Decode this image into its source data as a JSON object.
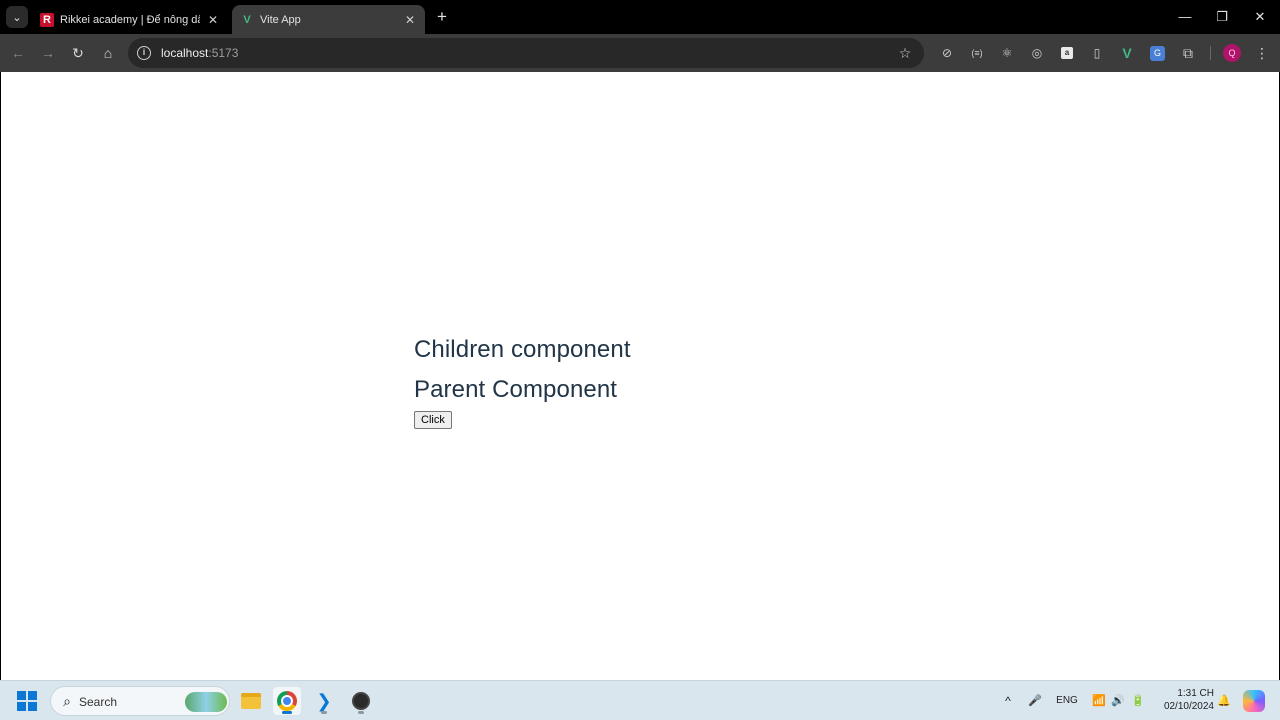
{
  "browser": {
    "tabs": [
      {
        "favicon": "rikkei-favicon",
        "favicon_glyph": "R",
        "title": "Rikkei academy | Để nông dân b",
        "close_glyph": "✕"
      },
      {
        "favicon": "vite-vue-favicon",
        "favicon_glyph": "V",
        "title": "Vite App",
        "close_glyph": "✕"
      }
    ],
    "tab_menu_glyph": "⌄",
    "new_tab_glyph": "+",
    "window_controls": {
      "minimize": "—",
      "restore": "❐",
      "close": "✕"
    },
    "toolbar": {
      "back": "←",
      "forward": "→",
      "reload": "↻",
      "home": "⌂",
      "info_glyph": "i",
      "url_host": "localhost",
      "url_port": ":5173",
      "bookmark": "☆"
    },
    "extensions": [
      {
        "name": "compass-icon",
        "glyph": "⊘"
      },
      {
        "name": "code-brackets-icon",
        "glyph": "(≡)"
      },
      {
        "name": "react-devtools-icon",
        "glyph": "⚛"
      },
      {
        "name": "target-icon",
        "glyph": "◎"
      },
      {
        "name": "box-extension-icon",
        "glyph": "a"
      },
      {
        "name": "phone-icon",
        "glyph": "▯"
      },
      {
        "name": "vue-devtools-icon",
        "glyph": "V"
      },
      {
        "name": "translate-icon",
        "glyph": "G"
      },
      {
        "name": "extensions-puzzle-icon",
        "glyph": "⧉"
      }
    ],
    "profile_initial": "Q",
    "menu_glyph": "⋮"
  },
  "page": {
    "heading_children": "Children component",
    "heading_parent": "Parent Component",
    "button_label": "Click"
  },
  "taskbar": {
    "search_placeholder": "Search",
    "search_glyph": "⌕",
    "tray": {
      "chevron": "^",
      "mic": "🎤",
      "language": "ENG",
      "wifi": "📶",
      "volume": "🔊",
      "battery": "🔋",
      "notification": "🔔"
    },
    "time": "1:31 CH",
    "date": "02/10/2024"
  },
  "colors": {
    "vue_green": "#42b883",
    "heading_text": "#213547",
    "windows_blue": "#0a78d4"
  }
}
